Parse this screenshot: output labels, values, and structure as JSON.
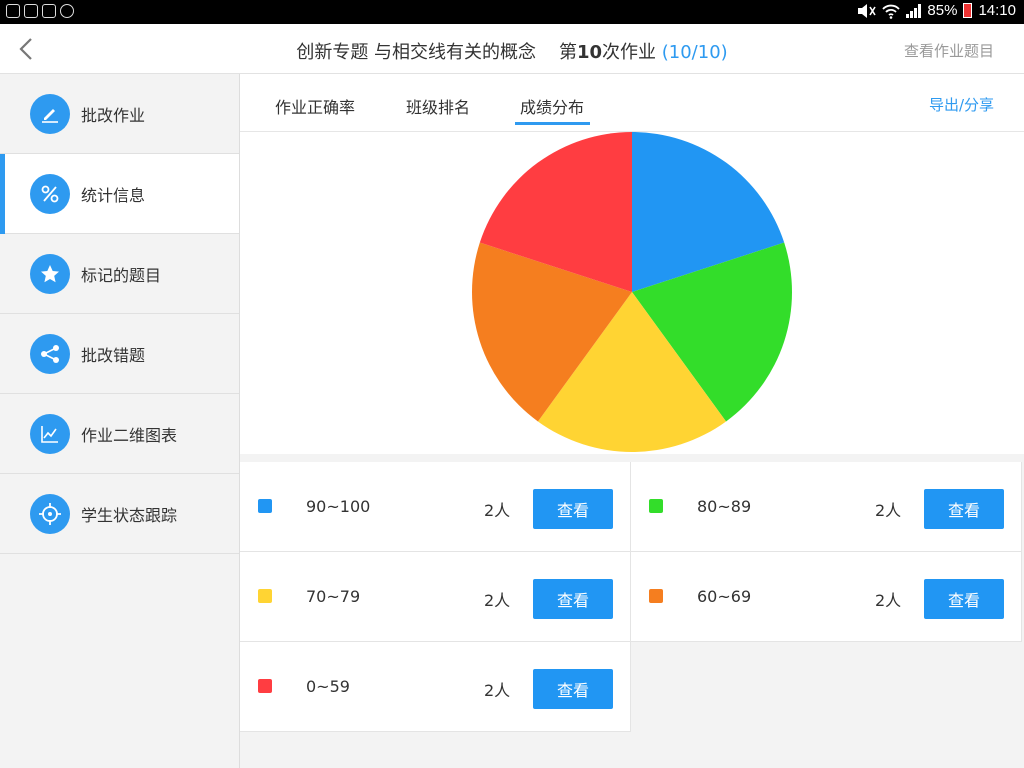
{
  "status": {
    "battery": "85%",
    "time": "14:10"
  },
  "header": {
    "title_part1": "创新专题 与相交线有关的概念",
    "title_part2_prefix": "第",
    "title_part2_number": "10",
    "title_part2_suffix": "次作业",
    "progress": "(10/10)",
    "view_questions": "查看作业题目"
  },
  "sidebar": {
    "items": [
      {
        "label": "批改作业",
        "icon": "pencil-icon",
        "active": false
      },
      {
        "label": "统计信息",
        "icon": "percent-icon",
        "active": true
      },
      {
        "label": "标记的题目",
        "icon": "star-icon",
        "active": false
      },
      {
        "label": "批改错题",
        "icon": "share-icon",
        "active": false
      },
      {
        "label": "作业二维图表",
        "icon": "chart-line-icon",
        "active": false
      },
      {
        "label": "学生状态跟踪",
        "icon": "target-icon",
        "active": false
      }
    ]
  },
  "tabs": {
    "items": [
      {
        "label": "作业正确率"
      },
      {
        "label": "班级排名"
      },
      {
        "label": "成绩分布"
      }
    ],
    "active_index": 2,
    "export_label": "导出/分享"
  },
  "chart_data": {
    "type": "pie",
    "categories": [
      "90~100",
      "80~89",
      "70~79",
      "60~69",
      "0~59"
    ],
    "values": [
      2,
      2,
      2,
      2,
      2
    ],
    "colors": [
      "#2196f3",
      "#33dd2a",
      "#ffd433",
      "#f57e1f",
      "#ff3d41"
    ]
  },
  "distribution": [
    {
      "range": "90~100",
      "count": "2人",
      "button": "查看",
      "color": "#2196f3"
    },
    {
      "range": "80~89",
      "count": "2人",
      "button": "查看",
      "color": "#33dd2a"
    },
    {
      "range": "70~79",
      "count": "2人",
      "button": "查看",
      "color": "#ffd433"
    },
    {
      "range": "60~69",
      "count": "2人",
      "button": "查看",
      "color": "#f57e1f"
    },
    {
      "range": "0~59",
      "count": "2人",
      "button": "查看",
      "color": "#ff3d41"
    }
  ]
}
